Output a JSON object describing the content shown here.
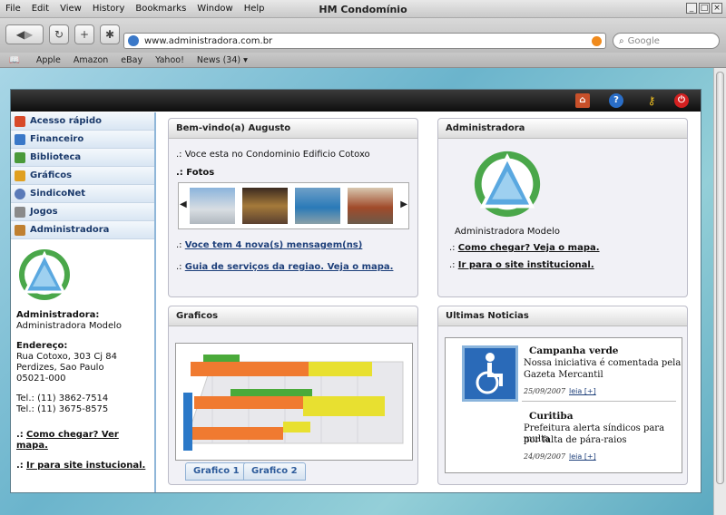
{
  "window": {
    "title": "HM Condomínio",
    "menus": [
      "File",
      "Edit",
      "View",
      "History",
      "Bookmarks",
      "Window",
      "Help"
    ]
  },
  "toolbar": {
    "url": "www.administradora.com.br",
    "search_placeholder": "Google"
  },
  "bookmarks": [
    "Apple",
    "Amazon",
    "eBay",
    "Yahoo!",
    "News (34) ▾"
  ],
  "sidebar": {
    "items": [
      {
        "label": "Acesso rápido",
        "color": "#d84a2a"
      },
      {
        "label": "Financeiro",
        "color": "#3a78c8"
      },
      {
        "label": "Biblioteca",
        "color": "#4a9a3a"
      },
      {
        "label": "Gráficos",
        "color": "#e0a020"
      },
      {
        "label": "SindicoNet",
        "color": "#5a7ab8"
      },
      {
        "label": "Jogos",
        "color": "#8a8a8a"
      },
      {
        "label": "Administradora",
        "color": "#c08030"
      }
    ],
    "info": {
      "admin_label": "Administradora:",
      "admin_value": "Administradora Modelo",
      "address_label": "Endereço:",
      "address_line1": "Rua Cotoxo, 303 Cj 84",
      "address_line2": "Perdizes, Sao Paulo",
      "address_line3": "05021-000",
      "tel1": "Tel.: (11) 3862-7514",
      "tel2": "Tel.: (11) 3675-8575",
      "link1_prefix": ".:",
      "link1": "Como chegar? Ver mapa.",
      "link2_prefix": ".:",
      "link2": "Ir para site instucional."
    }
  },
  "welcome": {
    "title": "Bem-vindo(a) Augusto",
    "line1": ".: Voce esta no Condominio Edificio Cotoxo",
    "fotos": ".: Fotos",
    "link1_prefix": ".:",
    "link1": "Voce tem 4 nova(s) mensagem(ns)",
    "link2_prefix": ".:",
    "link2": "Guia de serviços da regiao. Veja o mapa."
  },
  "admin_panel": {
    "title": "Administradora",
    "name": "Administradora Modelo",
    "link1_prefix": ".:",
    "link1": "Como chegar? Veja o mapa.",
    "link2_prefix": ".:",
    "link2": "Ir para o site institucional."
  },
  "graficos": {
    "title": "Graficos",
    "tab1": "Grafico 1",
    "tab2": "Grafico 2"
  },
  "noticias": {
    "title": "Ultimas Noticias",
    "items": [
      {
        "headline": "Campanha verde",
        "text1": "Nossa iniciativa é comentada pela",
        "text2": "Gazeta Mercantil",
        "date": "25/09/2007",
        "more": "leia [+]"
      },
      {
        "headline": "Curitiba",
        "text1": "Prefeitura alerta síndicos para multa",
        "text2": "por falta de pára-raios",
        "date": "24/09/2007",
        "more": "leia [+]"
      }
    ]
  }
}
